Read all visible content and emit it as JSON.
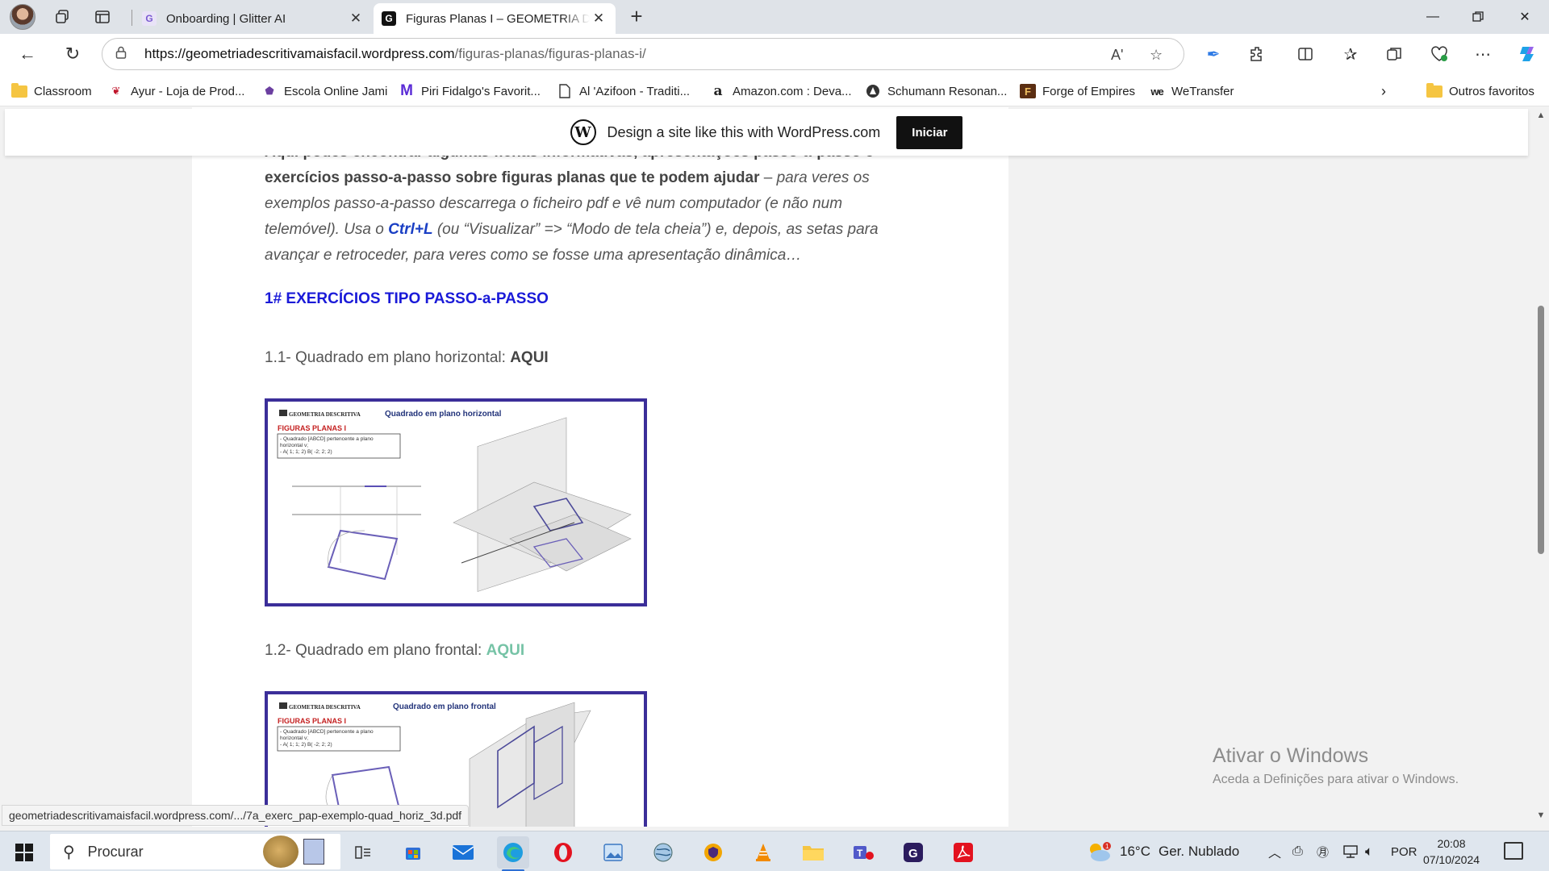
{
  "browser": {
    "tabs": [
      {
        "title": "Onboarding | Glitter AI",
        "favicon": "G"
      },
      {
        "title": "Figuras Planas I – GEOMETRIA DE",
        "favicon": "G"
      }
    ],
    "url_host": "https://geometriadescritivamaisfacil.wordpress.com",
    "url_path": "/figuras-planas/figuras-planas-i/",
    "read_aloud": "Aʹ",
    "favorites": [
      {
        "label": "Classroom"
      },
      {
        "label": "Ayur - Loja de Prod..."
      },
      {
        "label": "Escola Online Jami"
      },
      {
        "label": "Piri Fidalgo's Favorit..."
      },
      {
        "label": "Al 'Azifoon - Traditi..."
      },
      {
        "label": "Amazon.com : Deva..."
      },
      {
        "label": "Schumann Resonan..."
      },
      {
        "label": "Forge of Empires"
      },
      {
        "label": "WeTransfer"
      }
    ],
    "other_favorites": "Outros favoritos"
  },
  "wordpress_bar": {
    "text": "Design a site like this with WordPress.com",
    "button": "Iniciar"
  },
  "article": {
    "intro_cut": "Aqui podes encontrar algumas fichas informativas, apresentações passo-a-passo e",
    "intro_bold": "exercícios passo-a-passo sobre figuras planas que te podem ajudar",
    "intro_dash": " – ",
    "intro_em_1": "para veres os exemplos passo-a-passo descarrega o ficheiro pdf e vê num computador (e não num telemóvel). Usa o ",
    "ctrl": "Ctrl+L",
    "intro_em_2": " (ou “Visualizar” => “Modo de tela cheia”) e, depois, as setas para avançar e retroceder, para veres como se fosse uma apresentação dinâmica…",
    "section_heading": "1# EXERCÍCIOS TIPO PASSO-a-PASSO",
    "items": [
      {
        "text": "1.1- Quadrado em plano horizontal: ",
        "link": "AQUI",
        "thumb": {
          "brand": "GEOMETRIA DESCRITIVA",
          "title": "Quadrado em plano horizontal",
          "subtitle": "FIGURAS PLANAS I",
          "box_lines": [
            "- Quadrado [ABCD] pertencente a plano",
            "horizontal ν;",
            "- A( 1; 1; 2) B( -2; 2; 2)"
          ]
        }
      },
      {
        "text": "1.2- Quadrado em plano frontal:  ",
        "link": "AQUI",
        "thumb": {
          "brand": "GEOMETRIA DESCRITIVA",
          "title": "Quadrado em plano frontal",
          "subtitle": "FIGURAS PLANAS I",
          "box_lines": [
            "- Quadrado [ABCD] pertencente a plano",
            "horizontal ν;",
            "- A( 1; 1; 2) B( -2; 2; 2)"
          ]
        }
      }
    ]
  },
  "windows_watermark": {
    "line1": "Ativar o Windows",
    "line2": "Aceda a Definições para ativar o Windows."
  },
  "status_url": "geometriadescritivamaisfacil.wordpress.com/.../7a_exerc_pap-exemplo-quad_horiz_3d.pdf",
  "taskbar": {
    "search_placeholder": "Procurar",
    "weather_temp": "16°C",
    "weather_desc": "Ger. Nublado",
    "language": "POR",
    "time": "20:08",
    "date": "07/10/2024"
  },
  "colors": {
    "heading_blue": "#1a1ad8",
    "ctrl_blue": "#1a3fc4",
    "link_teal": "#76c3a6",
    "thumb_border": "#3b2e99"
  }
}
